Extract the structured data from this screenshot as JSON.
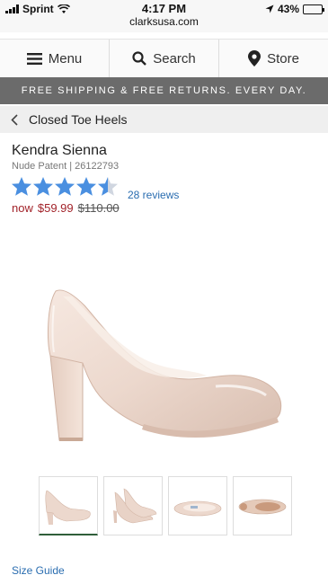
{
  "status": {
    "carrier": "Sprint",
    "time": "4:17 PM",
    "url": "clarksusa.com",
    "battery": "43%",
    "battery_level": 0.43
  },
  "nav": {
    "menu_label": "Menu",
    "search_label": "Search",
    "store_label": "Store"
  },
  "promo": {
    "text": "FREE SHIPPING & FREE RETURNS. EVERY DAY."
  },
  "breadcrumb": {
    "label": "Closed Toe Heels"
  },
  "product": {
    "name": "Kendra Sienna",
    "color": "Nude Patent",
    "separator": "|",
    "sku": "26122793",
    "rating": 4.5,
    "rating_max": 5,
    "reviews": "28 reviews",
    "price_label": "now",
    "price": "$59.99",
    "old_price": "$110.00"
  },
  "thumbnails": [
    {
      "view": "side-heel",
      "selected": true
    },
    {
      "view": "pair"
    },
    {
      "view": "inside"
    },
    {
      "view": "sole"
    }
  ],
  "size_guide": "Size Guide",
  "colors": {
    "star": "#4a8fe0",
    "star_empty": "#d0d6e0",
    "price_red": "#a2232a",
    "link_blue": "#2a6db0",
    "promo_bg": "#6b6b6b",
    "shoe_nude": "#ecd8cd"
  }
}
